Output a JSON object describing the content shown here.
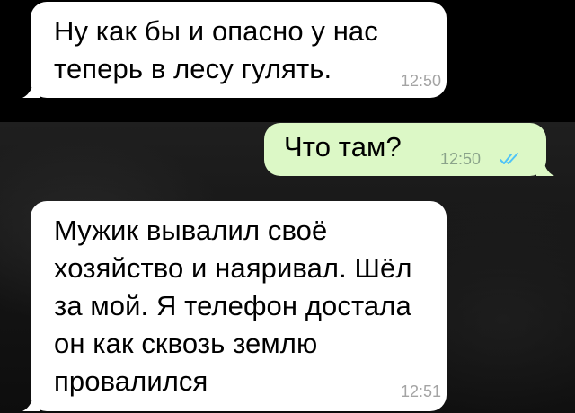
{
  "messages": [
    {
      "direction": "incoming",
      "text": "Ну как бы и опасно у нас\nтеперь в лесу гулять.",
      "time": "12:50"
    },
    {
      "direction": "outgoing",
      "text": "Что там?",
      "time": "12:50",
      "status": "read"
    },
    {
      "direction": "incoming",
      "text": "Мужик вывалил своё\nхозяйство и наяривал. Шёл\nза мой. Я телефон достала\nон как сквозь землю\nпровалился",
      "time": "12:51"
    }
  ],
  "colors": {
    "incoming_bubble": "#ffffff",
    "outgoing_bubble": "#dcf8c6",
    "read_ticks": "#4fc3f7",
    "timestamp": "#a4a4a4"
  },
  "icons": {
    "read_status": "double-check-icon"
  }
}
